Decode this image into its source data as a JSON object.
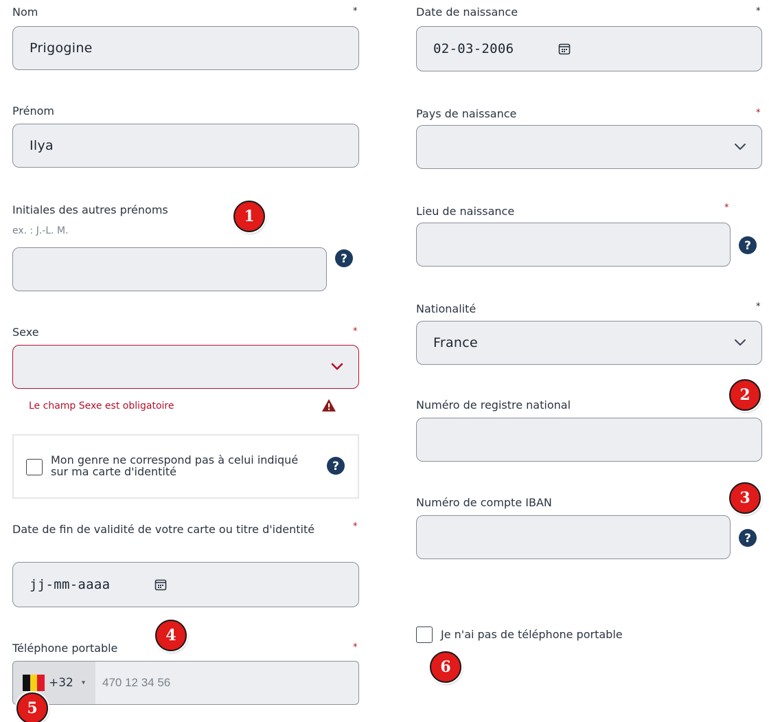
{
  "left": {
    "nom": {
      "label": "Nom",
      "value": "Prigogine",
      "required": "*"
    },
    "prenom": {
      "label": "Prénom",
      "value": "Ilya"
    },
    "initiales": {
      "label": "Initiales des autres prénoms",
      "hint": "ex. : J.-L. M.",
      "value": ""
    },
    "sexe": {
      "label": "Sexe",
      "required": "*",
      "value": "",
      "error": "Le champ Sexe est obligatoire"
    },
    "genre": {
      "label": "Mon genre ne correspond pas à celui indiqué sur ma carte d'identité",
      "checked": false
    },
    "date_fin": {
      "label": "Date de fin de validité de votre carte ou titre d'identité",
      "required": "*",
      "value": "jj-mm-aaaa"
    },
    "telephone": {
      "label": "Téléphone portable",
      "required": "*",
      "dial_code": "+32",
      "caret": "▾",
      "placeholder": "470 12 34 56"
    }
  },
  "right": {
    "date_naissance": {
      "label": "Date de naissance",
      "required": "*",
      "value": "02-03-2006"
    },
    "pays_naissance": {
      "label": "Pays de naissance",
      "required": "*",
      "value": ""
    },
    "lieu_naissance": {
      "label": "Lieu de naissance",
      "required": "*",
      "value": ""
    },
    "nationalite": {
      "label": "Nationalité",
      "required": "*",
      "value": "France"
    },
    "registre": {
      "label": "Numéro de registre national",
      "value": ""
    },
    "iban": {
      "label": "Numéro de compte IBAN",
      "value": ""
    },
    "no_phone": {
      "label": "Je n'ai pas de téléphone portable",
      "checked": false
    }
  },
  "badges": [
    "1",
    "2",
    "3",
    "4",
    "5",
    "6"
  ],
  "colors": {
    "error": "#b3102a",
    "badge": "#e11a1a",
    "help": "#1d3a5f",
    "field_bg": "#eceef1"
  },
  "icons": {
    "calendar": "calendar-icon",
    "chevron": "chevron-down-icon",
    "help": "help-circle-icon",
    "warning": "warning-icon",
    "flag": "belgium-flag-icon"
  }
}
